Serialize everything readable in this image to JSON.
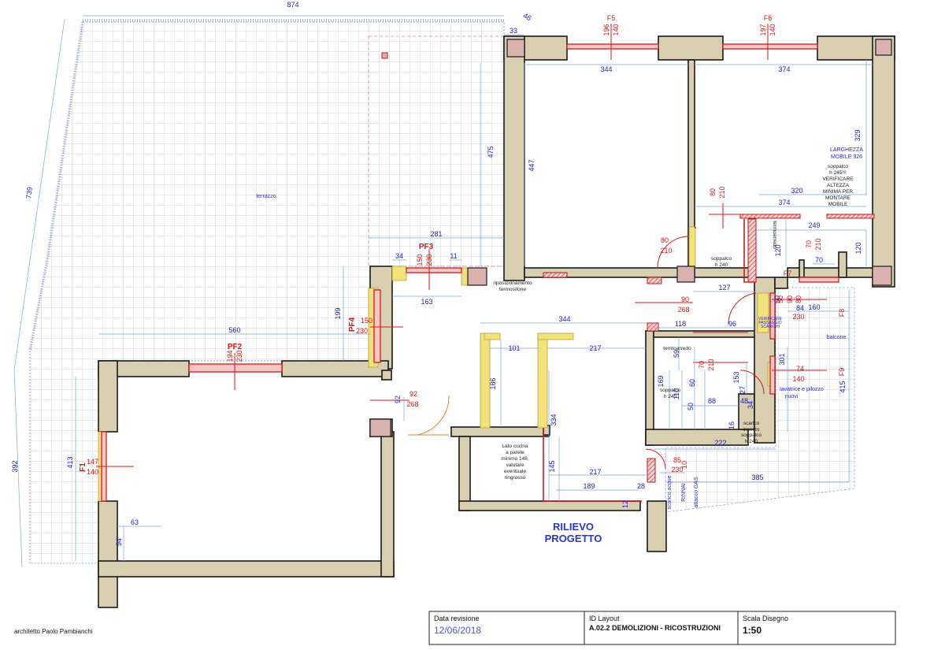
{
  "plan": {
    "terrace_label": "terrazzo",
    "balcony_label": "balcone",
    "stamp_line1": "RILIEVO",
    "stamp_line2": "PROGETTO",
    "windows": {
      "f1": "F1",
      "f1_w": "147",
      "f1_h": "140",
      "pf2": "PF2",
      "pf2_w": "194",
      "pf2_h": "230",
      "pf3": "PF3",
      "pf3_w": "150",
      "pf3_h": "230",
      "pf4": "PF4",
      "pf4_w": "150",
      "pf4_h": "230",
      "f5": "F5",
      "f5_w": "196",
      "f5_h": "140",
      "f6": "F6",
      "f6_w": "197",
      "f6_h": "140",
      "f7": "F7",
      "f8": "F8",
      "f9": "F9"
    },
    "dims": {
      "d874": "874",
      "d46": "46",
      "d33": "33",
      "d739": "739",
      "d392": "392",
      "d475": "475",
      "d447": "447",
      "d344_top": "344",
      "d374_top": "374",
      "d329": "329",
      "d320": "320",
      "d374_mid": "374",
      "d249": "249",
      "d120_a": "120",
      "d120_b": "120",
      "d70": "70",
      "d127": "127",
      "d281": "281",
      "d34": "34",
      "d11": "11",
      "d163": "163",
      "d199": "199",
      "d560": "560",
      "d413": "413",
      "d63": "63",
      "d94": "94",
      "d92": "92",
      "d344_mid": "344",
      "d101": "101",
      "d217_a": "217",
      "d186": "186",
      "d334": "334",
      "d145": "145",
      "d217_b": "217",
      "d189": "189",
      "d12": "12",
      "d28": "28",
      "d118": "118",
      "d59": "59",
      "d169": "169",
      "d110": "110",
      "d60": "60",
      "d50": "50",
      "d88": "88",
      "d153": "153",
      "d27": "27",
      "d48": "48",
      "d34_b": "34",
      "d16": "16",
      "d222": "222",
      "d385": "385",
      "d415": "415",
      "d301": "301",
      "d160": "160",
      "d96": "96",
      "d84": "84",
      "d50_b": "50",
      "d415_n": "415"
    },
    "red_dims": {
      "r80": "80",
      "r210_a": "210",
      "r80b": "80",
      "r210_b": "210",
      "r70": "70",
      "r210_c": "210",
      "r90": "90",
      "r268_a": "268",
      "r92": "92",
      "r268_b": "268",
      "r70b": "70",
      "r210_d": "210",
      "r74": "74",
      "r140": "140",
      "r85": "85",
      "r230_a": "230",
      "r10": "10",
      "r90b": "90",
      "r80c": "80",
      "r230_b": "230",
      "r50": "50"
    },
    "notes": {
      "larghezza_1": "LARGHEZZA",
      "larghezza_2": "MOBILE 326",
      "soppalco_note_1": "soppalco",
      "soppalco_note_2": "h 245!!!",
      "soppalco_note_3": "VERIFICARE",
      "soppalco_note_4": "ALTEZZA",
      "soppalco_note_5": "MINIMA PER",
      "soppalco_note_6": "MONTARE",
      "soppalco_note_7": "MOBILE",
      "soppalco_240_a1": "soppalco",
      "soppalco_240_a2": "h 240",
      "soppalco_240_b1": "soppalco",
      "soppalco_240_b2": "h 240",
      "soppalco_240_c": "soppalco",
      "soppalco_240_c2": "h 240",
      "termoarredo_1": "termoarredo",
      "termoarredo_2": "termoarredo",
      "riposizionamento_1": "riposizionamento",
      "riposizionamento_2": "termosifone",
      "lavatrice_1": "lavatrice e pilozzo",
      "lavatrice_2": "nuovi",
      "scarico_1": "scarico",
      "scarico_2": "inserito",
      "cucina_1": "Lato cucina",
      "cucina_2": "a parete",
      "cucina_3": "minimo 148,",
      "cucina_4": "valutare",
      "cucina_5": "eventuale",
      "cucina_6": "ringrosso",
      "verificare_1": "VERIFICARE",
      "verificare_2": "PASSAGGIO",
      "verificare_3": "SCARICHI",
      "scarico_acque": "scarico acque",
      "rinnai": "RINNAI",
      "attacco_gas": "attacco GAS"
    }
  },
  "title_block": {
    "author": "architetto Paolo Pambianchi",
    "revision_label": "Data revisione",
    "revision_date": "12/06/2018",
    "layout_label": "ID Layout",
    "layout_value": "A.02.2 DEMOLIZIONI - RICOSTRUZIONI",
    "scale_label": "Scala Disegno",
    "scale_value": "1:50"
  }
}
